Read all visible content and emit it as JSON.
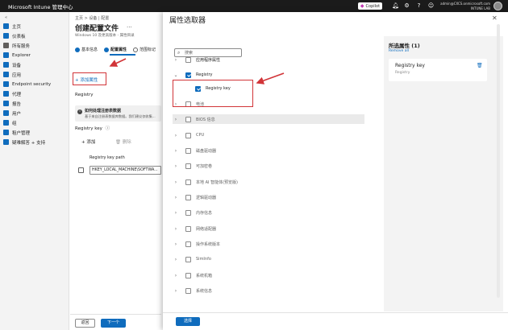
{
  "topbar": {
    "brand": "Microsoft Intune 管理中心",
    "copilot_label": "Copilot",
    "user_line1": "admin@CXCS.onmicrosoft.com",
    "user_line2": "INTUNE LAB"
  },
  "nav": {
    "collapse": "«",
    "items": [
      {
        "label": "主页",
        "color": "#0f6cbd"
      },
      {
        "label": "仪表板",
        "color": "#0f6cbd"
      },
      {
        "label": "所有服务",
        "color": "#605e5c"
      },
      {
        "label": "Explorer",
        "color": "#0f6cbd"
      },
      {
        "label": "设备",
        "color": "#0f6cbd"
      },
      {
        "label": "应用",
        "color": "#0f6cbd"
      },
      {
        "label": "Endpoint security",
        "color": "#0f6cbd"
      },
      {
        "label": "代理",
        "color": "#0f6cbd"
      },
      {
        "label": "报告",
        "color": "#0f6cbd"
      },
      {
        "label": "用户",
        "color": "#0f6cbd"
      },
      {
        "label": "组",
        "color": "#0f6cbd"
      },
      {
        "label": "租户管理",
        "color": "#0f6cbd"
      },
      {
        "label": "疑难解答 + 支持",
        "color": "#0f6cbd"
      }
    ]
  },
  "mid": {
    "breadcrumb": "主页 > 设备 | 配置",
    "title": "创建配置文件",
    "subtitle": "Windows 10 及更高版本 - 属性目录",
    "ellipsis": "...",
    "steps": [
      {
        "label": "基本信息",
        "color": "#0f6cbd"
      },
      {
        "label": "配置属性",
        "color": "#0f6cbd"
      },
      {
        "label": "范围标记",
        "color": "#ffffff"
      }
    ],
    "add_property_link": "+ 添加属性",
    "section_label": "Registry",
    "info_title": "如何处理注册表数据",
    "info_desc": "基于来自注册表数据库数据。我们建议仅收集...",
    "registry_key_label": "Registry key",
    "add_label": "+ 添加",
    "delete_label": "删除",
    "column_header": "Registry key path",
    "row_value": "HKEY_LOCAL_MACHINE\\SOFTWA...",
    "back_label": "返回",
    "next_label": "下一个"
  },
  "blade": {
    "title": "属性选取器",
    "close": "✕",
    "search_placeholder": "搜索",
    "tree": [
      {
        "label": "应用程序属性",
        "expanded": false,
        "checked": false,
        "level": 0
      },
      {
        "label": "Registry",
        "expanded": true,
        "checked": true,
        "level": 0
      },
      {
        "label": "Registry key",
        "expanded": false,
        "checked": true,
        "level": 1
      },
      {
        "label": "电池",
        "expanded": false,
        "checked": false,
        "level": 0
      },
      {
        "label": "BIOS 信息",
        "expanded": false,
        "checked": false,
        "level": 0,
        "highlight": true
      },
      {
        "label": "CPU",
        "expanded": false,
        "checked": false,
        "level": 0
      },
      {
        "label": "磁盘驱动器",
        "expanded": false,
        "checked": false,
        "level": 0
      },
      {
        "label": "可加密卷",
        "expanded": false,
        "checked": false,
        "level": 0
      },
      {
        "label": "本地 AI 智能体(预览版)",
        "expanded": false,
        "checked": false,
        "level": 0
      },
      {
        "label": "逻辑驱动器",
        "expanded": false,
        "checked": false,
        "level": 0
      },
      {
        "label": "内存信息",
        "expanded": false,
        "checked": false,
        "level": 0
      },
      {
        "label": "网络适配器",
        "expanded": false,
        "checked": false,
        "level": 0
      },
      {
        "label": "操作系统版本",
        "expanded": false,
        "checked": false,
        "level": 0
      },
      {
        "label": "SimInfo",
        "expanded": false,
        "checked": false,
        "level": 0
      },
      {
        "label": "系统机箱",
        "expanded": false,
        "checked": false,
        "level": 0
      },
      {
        "label": "系统信息",
        "expanded": false,
        "checked": false,
        "level": 0
      }
    ],
    "select_label": "选择",
    "selected_title": "所选属性 (1)",
    "remove_all": "Remove all",
    "selected_item_title": "Registry key",
    "selected_item_sub": "Registry"
  },
  "colors": {
    "accent": "#0f6cbd",
    "annotation_red": "#d13438"
  }
}
